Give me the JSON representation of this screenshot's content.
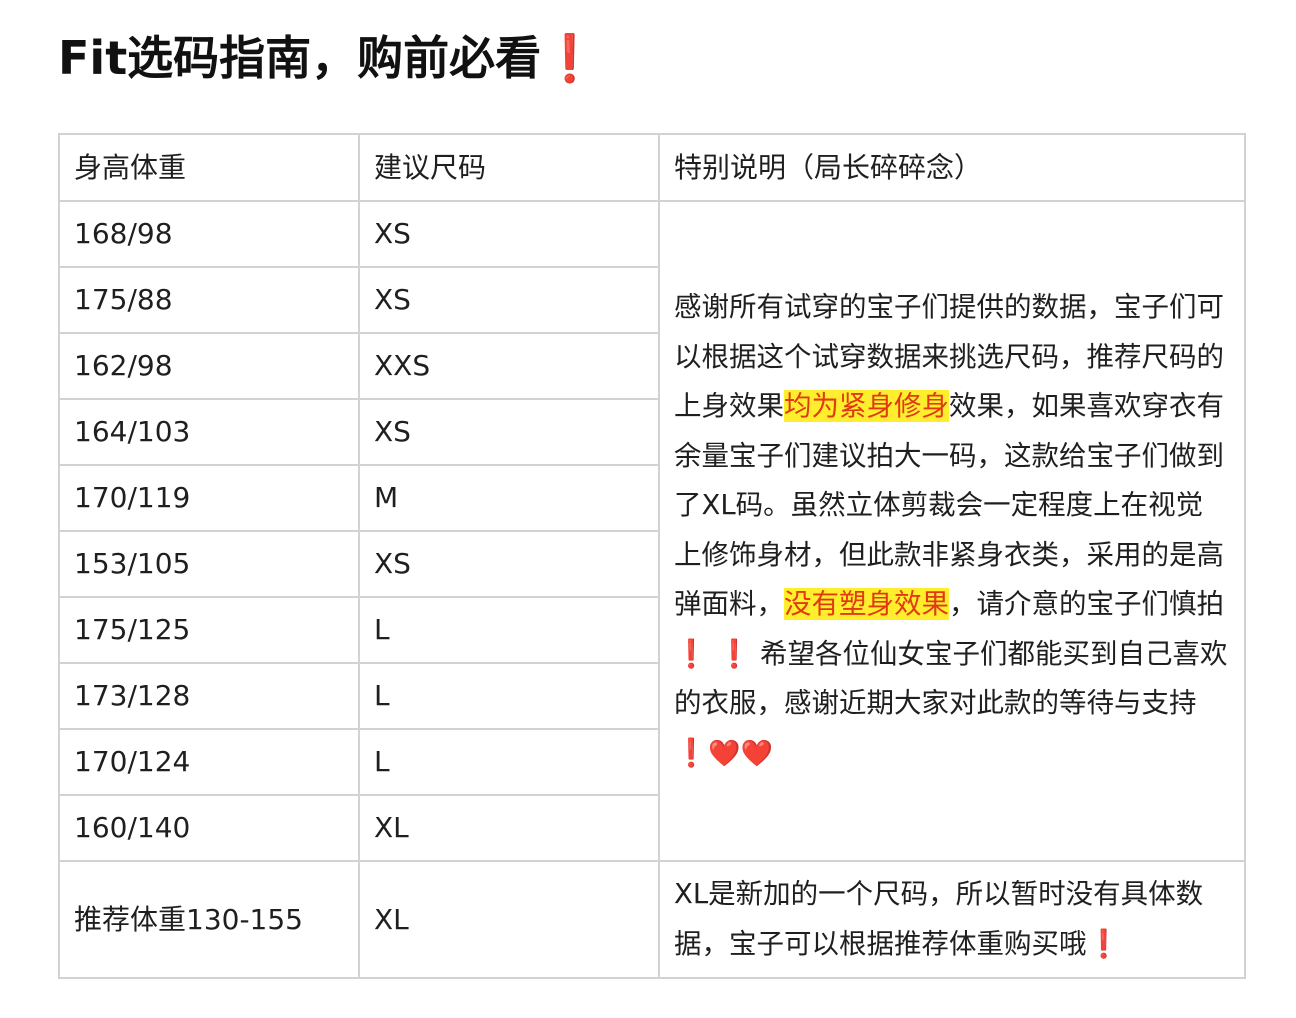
{
  "title": "Fit选码指南，购前必看",
  "title_mark": "❗",
  "columns": [
    "身高体重",
    "建议尺码",
    "特别说明（局长碎碎念）"
  ],
  "rows": [
    {
      "hw": "168/98",
      "size": "XS"
    },
    {
      "hw": "175/88",
      "size": "XS"
    },
    {
      "hw": "162/98",
      "size": "XXS"
    },
    {
      "hw": "164/103",
      "size": "XS"
    },
    {
      "hw": "170/119",
      "size": "M"
    },
    {
      "hw": "153/105",
      "size": "XS"
    },
    {
      "hw": "175/125",
      "size": "L"
    },
    {
      "hw": "173/128",
      "size": "L"
    },
    {
      "hw": "170/124",
      "size": "L"
    },
    {
      "hw": "160/140",
      "size": "XL"
    }
  ],
  "note": {
    "p1": "感谢所有试穿的宝子们提供的数据，宝子们可以根据这个试穿数据来挑选尺码，推荐尺码的上身效果",
    "hl1": "均为紧身修身",
    "p2": "效果，如果喜欢穿衣有余量宝子们建议拍大一码，这款给宝子们做到了XL码。虽然立体剪裁会一定程度上在视觉上修饰身材，但此款非紧身衣类，采用的是高弹面料，",
    "hl2": "没有塑身效果",
    "p3": "，请介意的宝子们慎拍",
    "mark1": "❗",
    "mark2": "❗",
    "p4": "希望各位仙女宝子们都能买到自己喜欢的衣服，感谢近期大家对此款的等待与支持",
    "mark3": "❗",
    "heart1": "❤️",
    "heart2": "❤️"
  },
  "last_row": {
    "hw": "推荐体重130-155",
    "size": "XL",
    "note": "XL是新加的一个尺码，所以暂时没有具体数据，宝子可以根据推荐体重购买哦",
    "note_mark": "❗"
  },
  "colors": {
    "highlight_bg": "#ffee2e",
    "highlight_text": "#e13a12",
    "exclamation": "#e3262b",
    "border": "#d2d2d2"
  }
}
